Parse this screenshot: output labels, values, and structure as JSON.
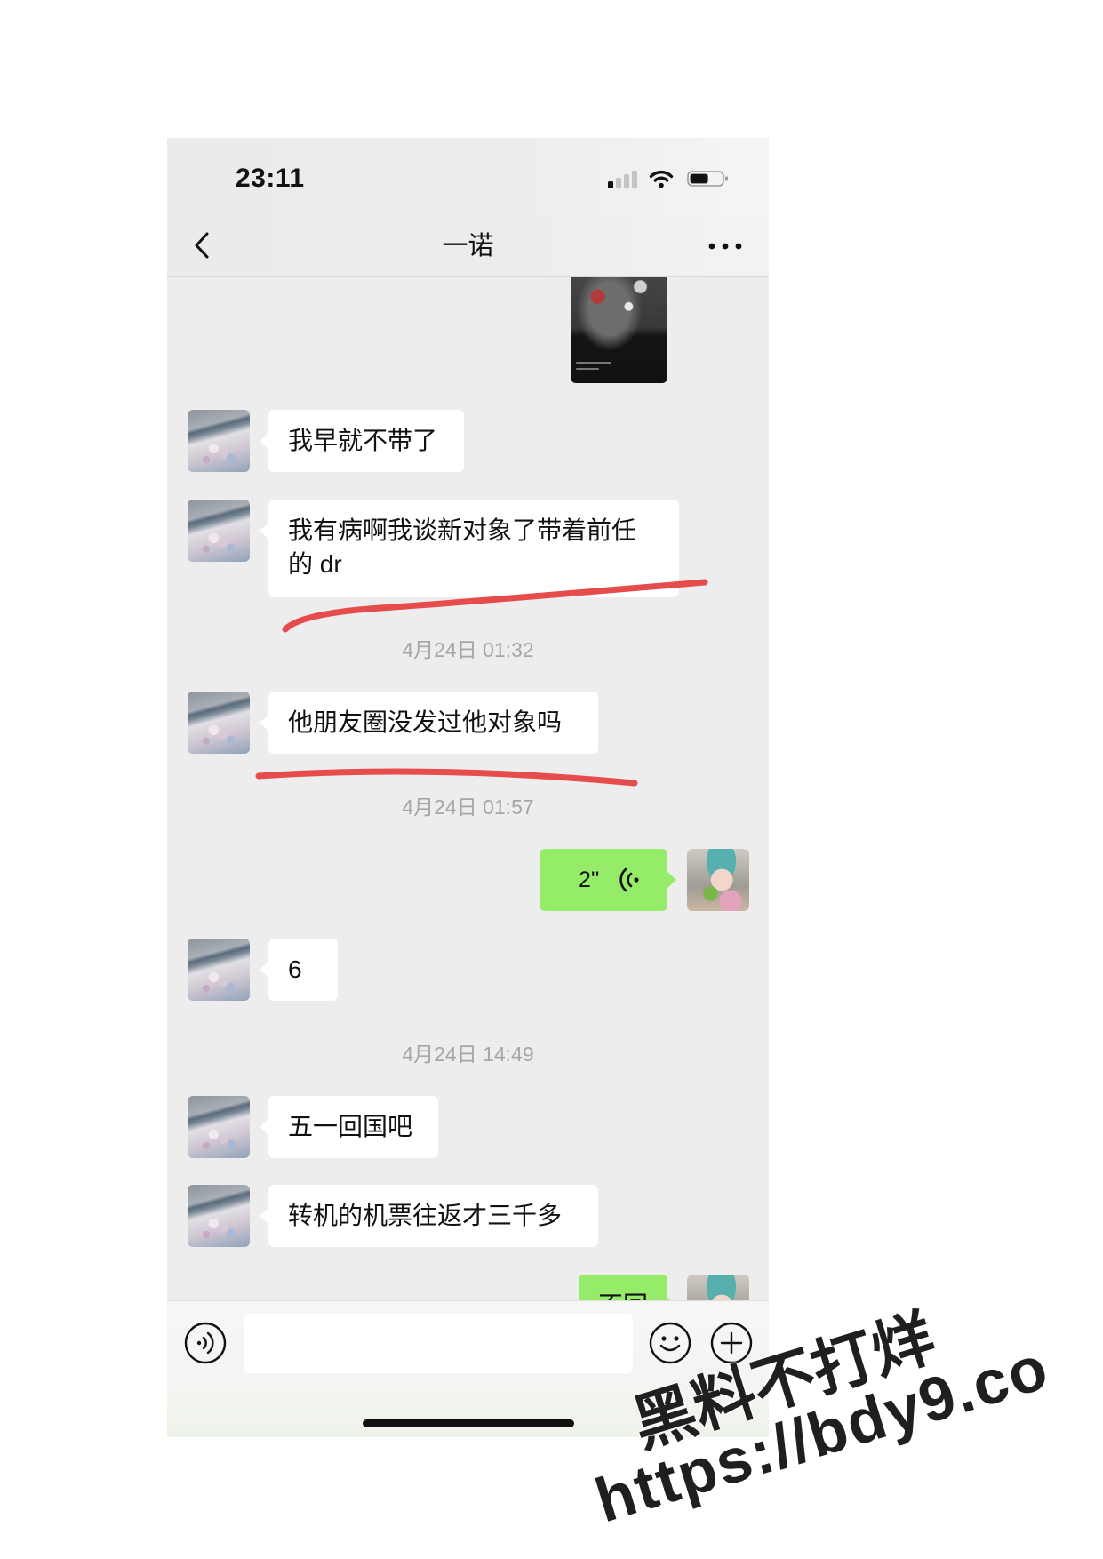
{
  "status_bar": {
    "time": "23:11",
    "signal_icon": "cellular-signal-icon",
    "wifi_icon": "wifi-icon",
    "battery_icon": "battery-icon",
    "battery_level": 0.5
  },
  "nav": {
    "title": "一诺",
    "back_icon": "chevron-left-icon",
    "more_icon": "more-dots-icon"
  },
  "chat": {
    "messages": [
      {
        "sender": "contact",
        "type": "image"
      },
      {
        "sender": "contact",
        "type": "text",
        "text": "我早就不带了"
      },
      {
        "sender": "contact",
        "type": "text",
        "text": "我有病啊我谈新对象了带着前任的 dr"
      },
      {
        "type": "timestamp",
        "text": "4月24日 01:32"
      },
      {
        "sender": "contact",
        "type": "text",
        "text": "他朋友圈没发过他对象吗"
      },
      {
        "type": "timestamp",
        "text": "4月24日 01:57"
      },
      {
        "sender": "self",
        "type": "voice",
        "duration": "2''"
      },
      {
        "sender": "contact",
        "type": "text",
        "text": "6"
      },
      {
        "type": "timestamp",
        "text": "4月24日 14:49"
      },
      {
        "sender": "contact",
        "type": "text",
        "text": "五一回国吧"
      },
      {
        "sender": "contact",
        "type": "text",
        "text": "转机的机票往返才三千多"
      },
      {
        "sender": "self",
        "type": "text",
        "text": "不回"
      }
    ],
    "red_underlined_messages": [
      2,
      4
    ]
  },
  "input_bar": {
    "voice_icon": "voice-input-icon",
    "emoji_icon": "emoji-icon",
    "plus_icon": "plus-circle-icon",
    "text_value": ""
  },
  "watermark": {
    "line1": "黑料不打烊",
    "line2": "https://bdy9.co"
  },
  "colors": {
    "chat_background": "#ededed",
    "self_bubble": "#95ec69",
    "contact_bubble": "#ffffff",
    "timestamp_text": "#a6a6a6",
    "underline_marker": "#e74c4c"
  }
}
